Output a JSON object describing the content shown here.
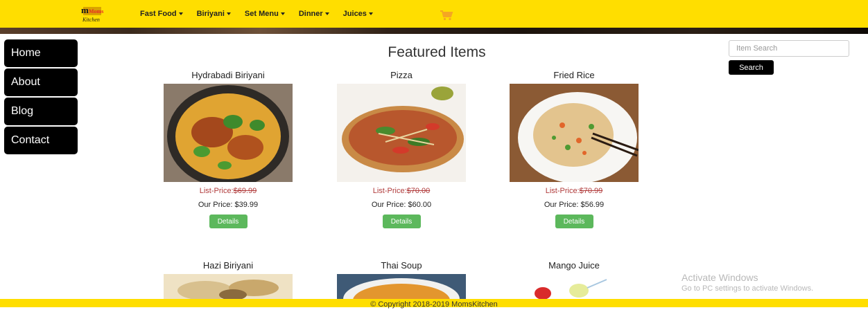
{
  "brand": {
    "logo_main": "Moms",
    "logo_sub": "Kitchen"
  },
  "nav": {
    "items": [
      "Fast Food",
      "Biriyani",
      "Set Menu",
      "Dinner",
      "Juices"
    ]
  },
  "sidebar": {
    "items": [
      "Home",
      "About",
      "Blog",
      "Contact"
    ]
  },
  "main": {
    "title": "Featured Items"
  },
  "search": {
    "placeholder": "Item Search",
    "button_label": "Search"
  },
  "labels": {
    "list_price": "List-Price:",
    "our_price": "Our Price: ",
    "details": "Details"
  },
  "products": [
    {
      "name": "Hydrabadi Biriyani",
      "list_price": "$69.99",
      "our_price": "$39.99"
    },
    {
      "name": "Pizza",
      "list_price": "$70.00",
      "our_price": "$60.00"
    },
    {
      "name": "Fried Rice",
      "list_price": "$70.99",
      "our_price": "$56.99"
    },
    {
      "name": "Hazi Biriyani"
    },
    {
      "name": "Thai Soup"
    },
    {
      "name": "Mango Juice"
    }
  ],
  "watermark": {
    "title": "Activate Windows",
    "subtitle": "Go to PC settings to activate Windows."
  },
  "footer": {
    "text": "© Copyright 2018-2019 MomsKitchen"
  },
  "colors": {
    "topbar": "#ffde00",
    "sidebar": "#000000",
    "details_button": "#5cb85c",
    "list_price": "#b03a3a",
    "cart_icon": "#f5a623"
  }
}
